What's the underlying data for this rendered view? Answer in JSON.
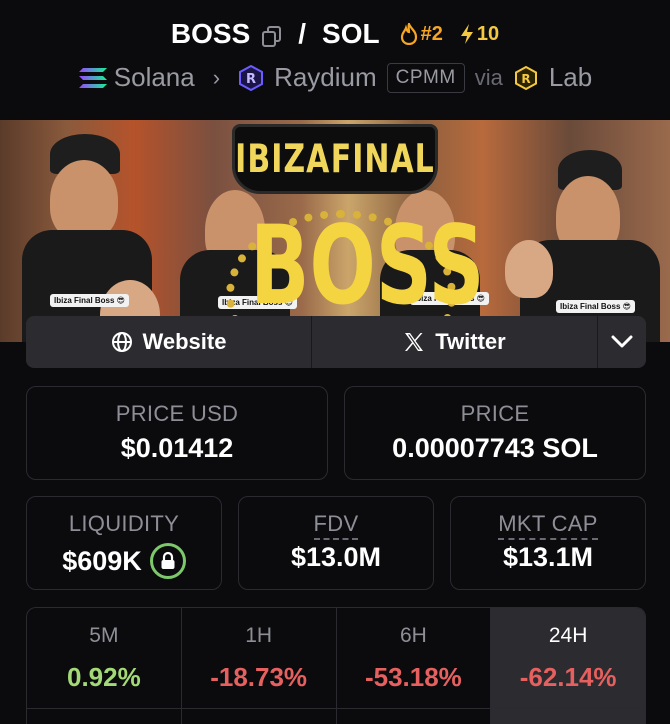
{
  "pair": {
    "base": "BOSS",
    "separator": "/",
    "quote": "SOL",
    "rank": "#2",
    "boosts": "10"
  },
  "route": {
    "chain": "Solana",
    "dex": "Raydium",
    "pool_type": "CPMM",
    "via_label": "via",
    "launchpad": "Lab"
  },
  "banner": {
    "glasses_left": "IBIZA",
    "glasses_right": "FINAL",
    "big_text": "BOSS",
    "caption": "Ibiza Final Boss 😎"
  },
  "links": {
    "website": "Website",
    "twitter": "Twitter"
  },
  "stats": {
    "price_usd_label": "PRICE USD",
    "price_usd": "$0.01412",
    "price_label": "PRICE",
    "price_native": "0.00007743 SOL",
    "liquidity_label": "LIQUIDITY",
    "liquidity": "$609K",
    "fdv_label": "FDV",
    "fdv": "$13.0M",
    "mcap_label": "MKT CAP",
    "mcap": "$13.1M"
  },
  "changes": [
    {
      "period": "5M",
      "value": "0.92%",
      "color": "#a3d977"
    },
    {
      "period": "1H",
      "value": "-18.73%",
      "color": "#e5605e"
    },
    {
      "period": "6H",
      "value": "-53.18%",
      "color": "#e5605e"
    },
    {
      "period": "24H",
      "value": "-62.14%",
      "color": "#e5605e"
    }
  ],
  "colors": {
    "background": "#0b0b0e",
    "positive": "#a3d977",
    "negative": "#e5605e",
    "rank": "#f5a623",
    "boost": "#f5c842"
  }
}
